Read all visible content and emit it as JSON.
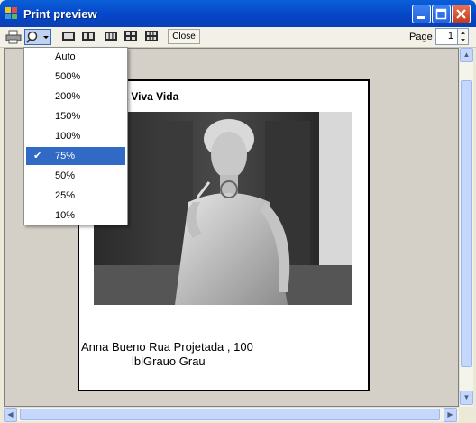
{
  "window": {
    "title": "Print preview"
  },
  "toolbar": {
    "close_label": "Close",
    "page_label": "Page",
    "page_value": "1"
  },
  "zoom_menu": {
    "items": [
      "Auto",
      "500%",
      "200%",
      "150%",
      "100%",
      "75%",
      "50%",
      "25%",
      "10%"
    ],
    "selected": "75%"
  },
  "document": {
    "heading": "cola Viva Vida",
    "line1": "Anna Bueno Rua Projetada , 100",
    "line2": "lblGrauo  Grau"
  },
  "colors": {
    "title_bar": "#0546c8",
    "menu_highlight": "#316ac5",
    "close_button": "#c43a1c"
  }
}
